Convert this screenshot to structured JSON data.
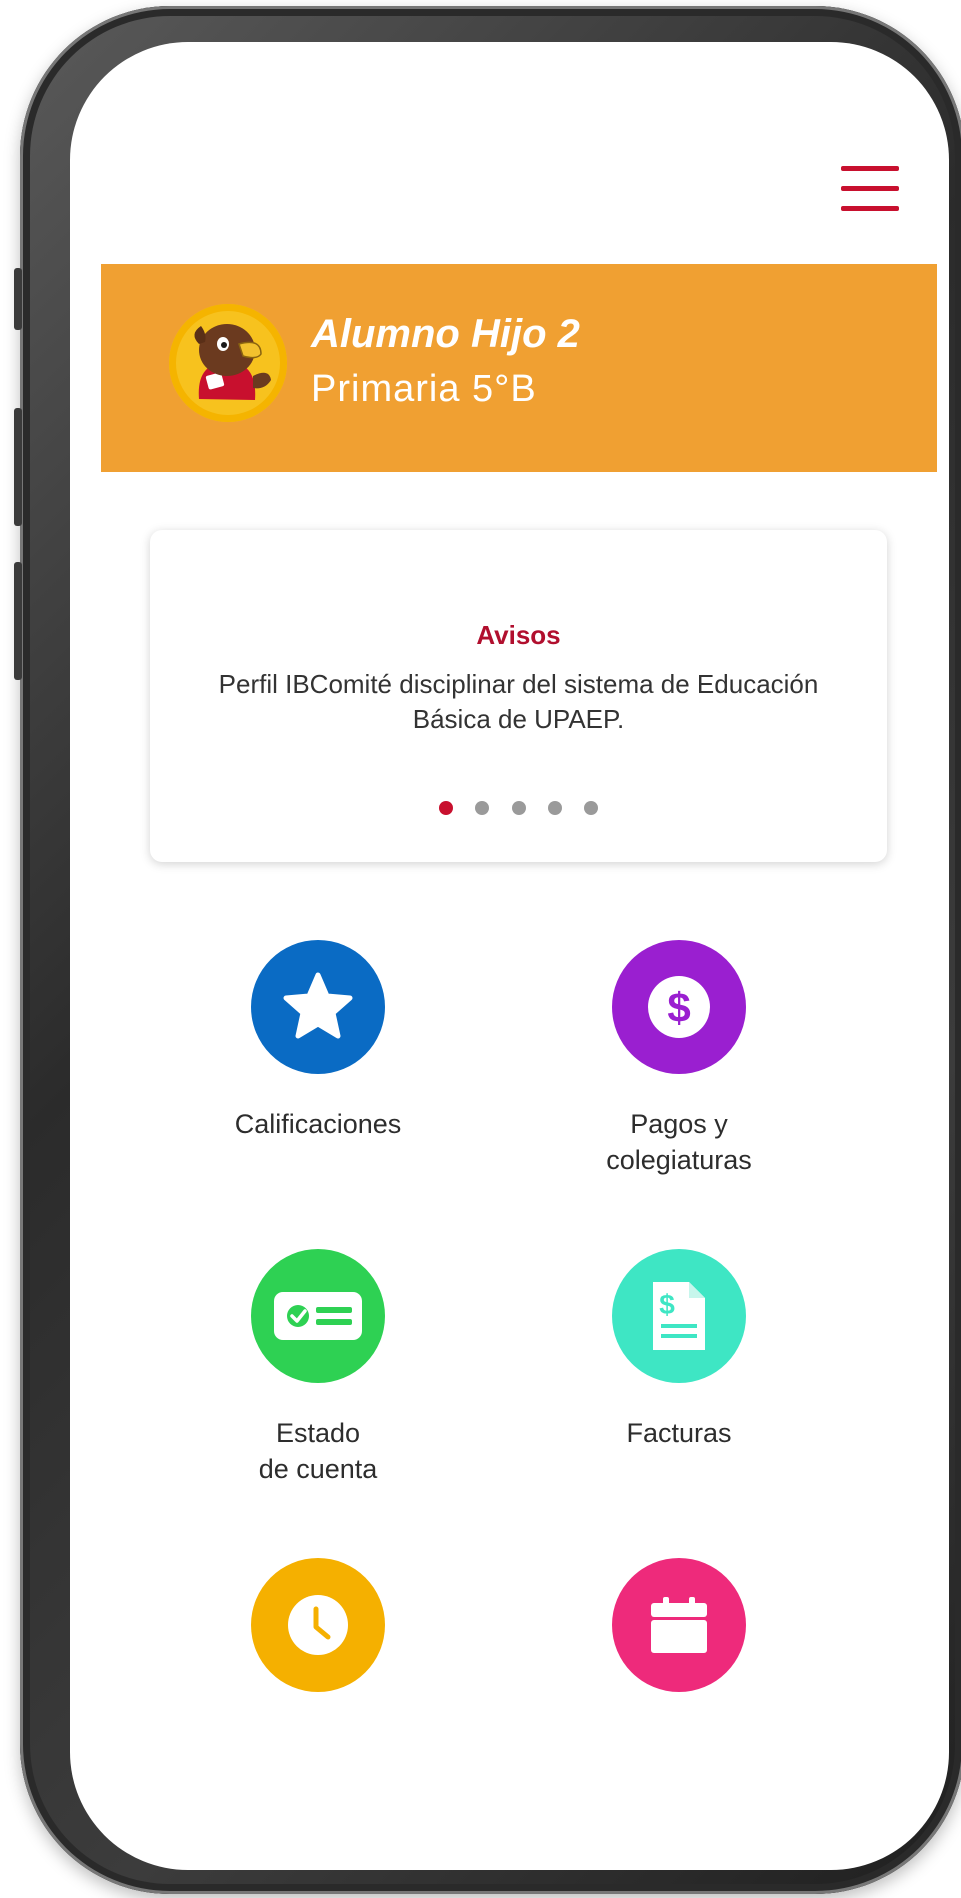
{
  "header": {
    "student_name": "Alumno Hijo 2",
    "student_grade": "Primaria 5°B"
  },
  "notices": {
    "title": "Avisos",
    "text": "Perfil IBComité disciplinar del sistema de Educación Básica de UPAEP.",
    "pages": 5,
    "active_page": 1
  },
  "menu": [
    {
      "label": "Calificaciones",
      "icon": "star-icon",
      "color": "#0a6bc4"
    },
    {
      "label": "Pagos y\ncolegiaturas",
      "icon": "dollar-icon",
      "color": "#9a1fd0"
    },
    {
      "label": "Estado\nde cuenta",
      "icon": "id-card-icon",
      "color": "#2ed153"
    },
    {
      "label": "Facturas",
      "icon": "invoice-icon",
      "color": "#3ee6c4"
    },
    {
      "label": "",
      "icon": "clock-icon",
      "color": "#f5b000"
    },
    {
      "label": "",
      "icon": "calendar-icon",
      "color": "#ee2a7b"
    }
  ],
  "colors": {
    "accent": "#c8102e",
    "banner": "#f0a032"
  }
}
